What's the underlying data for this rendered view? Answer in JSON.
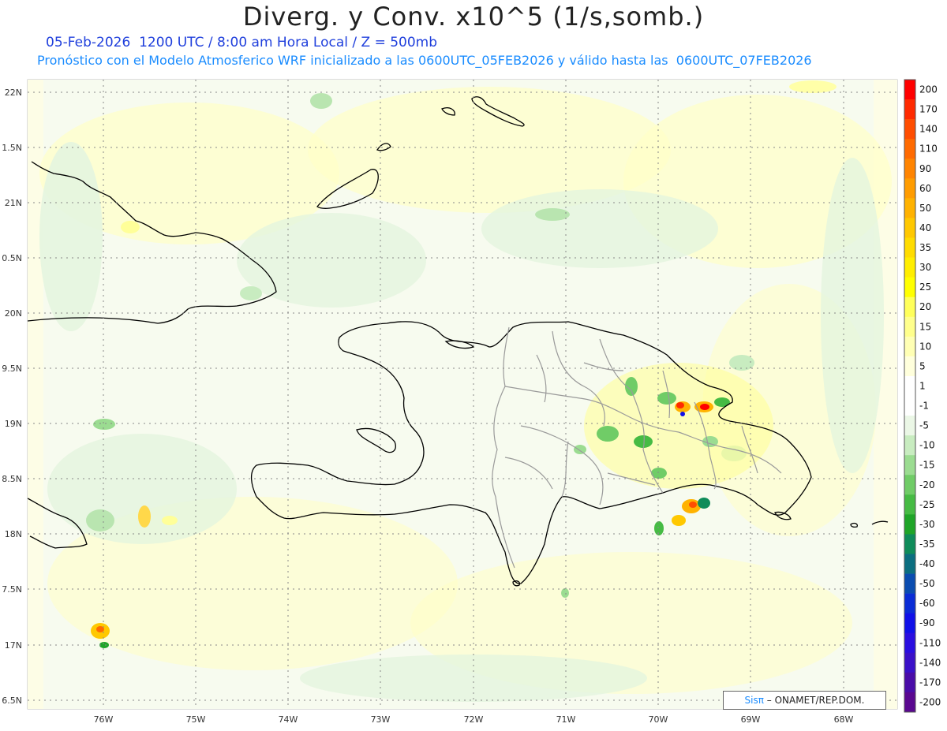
{
  "header": {
    "title": "Diverg. y Conv. x10^5 (1/s,somb.)",
    "subtitle_date": "05-Feb-2026  1200 UTC / 8:00 am Hora Local / Z = 500mb",
    "subtitle_model": "Pronóstico con el Modelo Atmosferico WRF inicializado a las 0600UTC_05FEB2026 y válido hasta las  0600UTC_07FEB2026"
  },
  "map": {
    "lat_labels": [
      "22N",
      "1.5N",
      "21N",
      "0.5N",
      "20N",
      "9.5N",
      "19N",
      "8.5N",
      "18N",
      "7.5N",
      "17N",
      "6.5N"
    ],
    "lon_labels": [
      "76W",
      "75W",
      "74W",
      "73W",
      "72W",
      "71W",
      "70W",
      "69W",
      "68W"
    ]
  },
  "colorbar": {
    "labels": [
      "200",
      "170",
      "140",
      "110",
      "90",
      "60",
      "50",
      "40",
      "35",
      "30",
      "25",
      "20",
      "15",
      "10",
      "5",
      "1",
      "-1",
      "-5",
      "-10",
      "-15",
      "-20",
      "-25",
      "-30",
      "-35",
      "-40",
      "-50",
      "-60",
      "-90",
      "-110",
      "-140",
      "-170",
      "-200"
    ],
    "colors": [
      "#ff0000",
      "#ff2a00",
      "#ff4d00",
      "#ff6a00",
      "#ff8400",
      "#ff9c00",
      "#ffb200",
      "#ffc800",
      "#ffdc00",
      "#ffee00",
      "#ffff00",
      "#ffff5a",
      "#ffff8c",
      "#ffffb4",
      "#ffffdc",
      "#ffffff",
      "#ffffff",
      "#ebf7e6",
      "#c8ecc0",
      "#9bdc91",
      "#70cc67",
      "#46bb44",
      "#1fa528",
      "#0f8c5a",
      "#0b6e80",
      "#0a4cb0",
      "#0a2cd6",
      "#1010e8",
      "#2a0ee0",
      "#3a10c8",
      "#4a0ca8",
      "#5a0890"
    ]
  },
  "credit": {
    "brand": "Sisπ",
    "text": " – ONAMET/REP.DOM."
  }
}
